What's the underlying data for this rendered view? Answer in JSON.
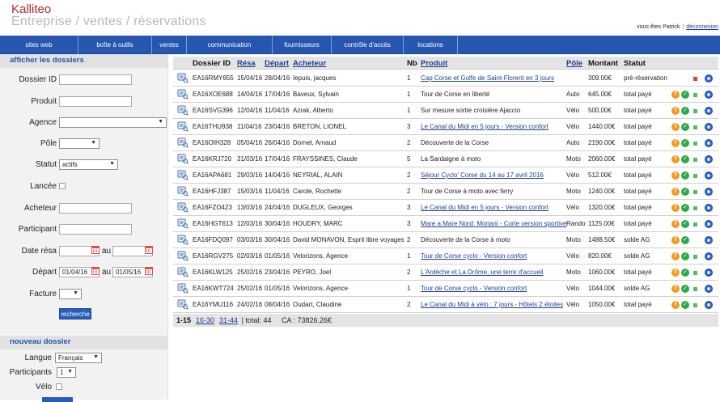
{
  "header": {
    "brand": "Kalliteo",
    "subtitle": "Entreprise / ventes / réservations",
    "user_text": "vous êtes Patrick",
    "separator": "|",
    "logout": "déconnexion"
  },
  "nav": [
    {
      "label": "sites web",
      "width": 97
    },
    {
      "label": "boîte à outils",
      "width": 91
    },
    {
      "label": "ventes",
      "width": 43
    },
    {
      "label": "communication",
      "width": 106
    },
    {
      "label": "fournisseurs",
      "width": 73
    },
    {
      "label": "contrôle d'accès",
      "width": 89
    },
    {
      "label": "locations",
      "width": 67
    }
  ],
  "sidebar": {
    "section1": "afficher les dossiers",
    "labels": {
      "dossier_id": "Dossier ID",
      "produit": "Produit",
      "agence": "Agence",
      "pole": "Pôle",
      "statut": "Statut",
      "lancee": "Lancée",
      "acheteur": "Acheteur",
      "participant": "Participant",
      "date_resa": "Date résa",
      "depart": "Départ",
      "facture": "Facture",
      "au": "au"
    },
    "values": {
      "statut": "actifs",
      "depart_from": "01/04/16",
      "depart_to": "01/05/16"
    },
    "search_button": "recherche",
    "section2": "nouveau dossier",
    "new": {
      "langue_label": "Langue",
      "langue_value": "Français",
      "participants_label": "Participants",
      "participants_value": "1",
      "velo_label": "Vélo"
    }
  },
  "table": {
    "headers": {
      "dossier": "Dossier ID",
      "resa": "Résa",
      "depart": "Départ",
      "acheteur": "Acheteur",
      "nb": "Nb",
      "produit": "Produit",
      "pole": "Pôle",
      "montant": "Montant",
      "statut": "Statut"
    },
    "rows": [
      {
        "id": "EA16RMY655",
        "resa": "15/04/16",
        "depart": "28/04/16",
        "acheteur": "Iepuis, jacques",
        "nb": "1",
        "produit": "Cap Corse et Golfe de Saint-Florent en 3 jours",
        "link": true,
        "pole": "",
        "montant": "309.00€",
        "statut": "pré-réservation",
        "f": false,
        "ok": false,
        "sq": "#e04030"
      },
      {
        "id": "EA16XOE688",
        "resa": "14/04/16",
        "depart": "17/04/16",
        "acheteur": "Baveux, Sylvain",
        "nb": "1",
        "produit": "Tour de Corse en liberté",
        "link": false,
        "pole": "Auto",
        "montant": "645.00€",
        "statut": "total payé",
        "f": true,
        "ok": true,
        "sq": "#5cb85c"
      },
      {
        "id": "EA16SVG396",
        "resa": "12/04/16",
        "depart": "11/04/16",
        "acheteur": "Azrak, Alberto",
        "nb": "1",
        "produit": "Sur mesure sortie croisière Ajaccio",
        "link": false,
        "pole": "Vélo",
        "montant": "500.00€",
        "statut": "total payé",
        "f": true,
        "ok": true,
        "sq": "#5cb85c"
      },
      {
        "id": "EA16THU938",
        "resa": "11/04/16",
        "depart": "23/04/16",
        "acheteur": "BRETON, LIONEL",
        "nb": "3",
        "produit": "Le Canal du Midi en 5 jours - Version confort",
        "link": true,
        "pole": "Vélo",
        "montant": "1440.00€",
        "statut": "total payé",
        "f": true,
        "ok": true,
        "sq": "#5cb85c"
      },
      {
        "id": "EA16OIH328",
        "resa": "05/04/16",
        "depart": "26/04/16",
        "acheteur": "Dornel, Arnaud",
        "nb": "2",
        "produit": "Découverte de la Corse",
        "link": false,
        "pole": "Auto",
        "montant": "2190.00€",
        "statut": "total payé",
        "f": true,
        "ok": true,
        "sq": "#5cb85c"
      },
      {
        "id": "EA16KRJ720",
        "resa": "31/03/16",
        "depart": "17/04/16",
        "acheteur": "FRAYSSINES, Claude",
        "nb": "5",
        "produit": "La Sardaigne à moto",
        "link": false,
        "pole": "Moto",
        "montant": "2060.00€",
        "statut": "total payé",
        "f": true,
        "ok": true,
        "sq": "#5cb85c"
      },
      {
        "id": "EA16APA681",
        "resa": "29/03/16",
        "depart": "14/04/16",
        "acheteur": "NEYRIAL, ALAIN",
        "nb": "2",
        "produit": "Séjour Cyclo' Corse du 14 au 17 avril 2016",
        "link": true,
        "pole": "Vélo",
        "montant": "512.00€",
        "statut": "total payé",
        "f": true,
        "ok": true,
        "sq": "#5cb85c"
      },
      {
        "id": "EA16HFJ387",
        "resa": "15/03/16",
        "depart": "11/04/16",
        "acheteur": "Carole, Rochette",
        "nb": "2",
        "produit": "Tour de Corse à moto avec ferry",
        "link": false,
        "pole": "Moto",
        "montant": "1240.00€",
        "statut": "total payé",
        "f": true,
        "ok": true,
        "sq": "#5cb85c"
      },
      {
        "id": "EA16FZO423",
        "resa": "13/03/16",
        "depart": "24/04/16",
        "acheteur": "DUGLEUX, Georges",
        "nb": "3",
        "produit": "Le Canal du Midi en 5 jours - Version confort",
        "link": true,
        "pole": "Vélo",
        "montant": "1320.00€",
        "statut": "total payé",
        "f": true,
        "ok": true,
        "sq": "#5cb85c"
      },
      {
        "id": "EA16HGT613",
        "resa": "12/03/16",
        "depart": "30/04/16",
        "acheteur": "HOUDRY, MARC",
        "nb": "3",
        "produit": "Mare a Mare Nord: Moriani - Corte version sportive",
        "link": true,
        "pole": "Rando",
        "montant": "1125.00€",
        "statut": "total payé",
        "f": true,
        "ok": true,
        "sq": "#5cb85c"
      },
      {
        "id": "EA16FDQ097",
        "resa": "03/03/16",
        "depart": "30/04/16",
        "acheteur": "David MONAVON, Esprit libre voyages",
        "nb": "2",
        "produit": "Découverte de la Corse à moto",
        "link": false,
        "pole": "Moto",
        "montant": "1488.50€",
        "statut": "solde AG",
        "f": true,
        "ok": true,
        "sq": ""
      },
      {
        "id": "EA16RGV275",
        "resa": "02/03/16",
        "depart": "01/05/16",
        "acheteur": "Velorizons, Agence",
        "nb": "1",
        "produit": "Tour de Corse cyclo - Version confort",
        "link": true,
        "pole": "Vélo",
        "montant": "820.00€",
        "statut": "solde AG",
        "f": true,
        "ok": true,
        "sq": "#5cb85c"
      },
      {
        "id": "EA16KLW125",
        "resa": "25/02/16",
        "depart": "23/04/16",
        "acheteur": "PEYRO, Joel",
        "nb": "2",
        "produit": "L'Ardèche et La Drôme, une terre d'accueil",
        "link": true,
        "pole": "Moto",
        "montant": "1060.00€",
        "statut": "total payé",
        "f": true,
        "ok": true,
        "sq": "#5cb85c"
      },
      {
        "id": "EA16KWT724",
        "resa": "25/02/16",
        "depart": "01/05/16",
        "acheteur": "Velorizons, Agence",
        "nb": "1",
        "produit": "Tour de Corse cyclo - Version confort",
        "link": true,
        "pole": "Vélo",
        "montant": "1044.00€",
        "statut": "solde AG",
        "f": true,
        "ok": true,
        "sq": "#5cb85c"
      },
      {
        "id": "EA16YMU116",
        "resa": "24/02/16",
        "depart": "08/04/16",
        "acheteur": "Oudart, Claudine",
        "nb": "2",
        "produit": "Le Canal du Midi à vélo : 7 jours - Hôtels 2 étoiles",
        "link": true,
        "pole": "Vélo",
        "montant": "1050.00€",
        "statut": "total payé",
        "f": true,
        "ok": true,
        "sq": "#5cb85c"
      }
    ]
  },
  "pager": {
    "current": "1-15",
    "page2": "16-30",
    "page3": "31-44",
    "total": "| total: 44",
    "ca": "CA : 73826.26€"
  }
}
